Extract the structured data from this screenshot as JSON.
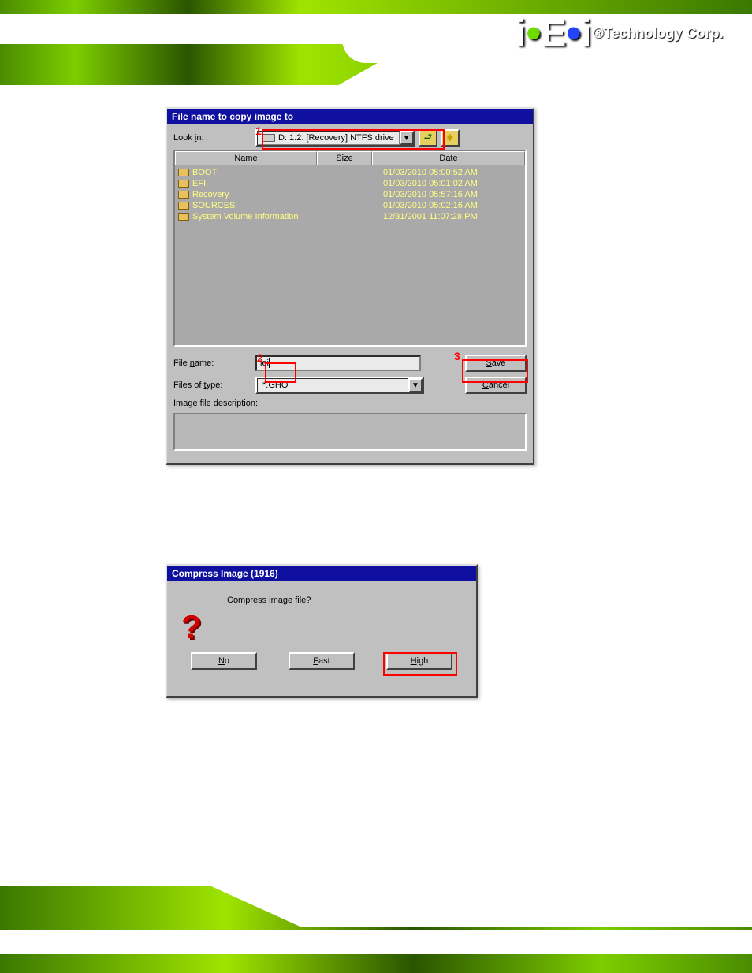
{
  "header": {
    "logo_text": "iEi",
    "tagline": "®Technology Corp."
  },
  "dialog1": {
    "title": "File name to copy image to",
    "look_in_label": "Look in:",
    "look_in_value": "D: 1.2: [Recovery] NTFS drive",
    "mark1": "1",
    "mark2": "2",
    "mark3": "3",
    "cols": {
      "name": "Name",
      "size": "Size",
      "date": "Date"
    },
    "rows": [
      {
        "name": "BOOT",
        "size": "",
        "date": "01/03/2010 05:00:52 AM"
      },
      {
        "name": "EFI",
        "size": "",
        "date": "01/03/2010 05:01:02 AM"
      },
      {
        "name": "Recovery",
        "size": "",
        "date": "01/03/2010 05:57:16 AM"
      },
      {
        "name": "SOURCES",
        "size": "",
        "date": "01/03/2010 05:02:16 AM"
      },
      {
        "name": "System Volume Information",
        "size": "",
        "date": "12/31/2001 11:07:28 PM"
      }
    ],
    "file_name_label": "File name:",
    "file_name_value": "iei",
    "files_type_label": "Files of type:",
    "files_type_value": "*.GHO",
    "desc_label": "Image file description:",
    "btn_save": "Save",
    "btn_cancel": "Cancel"
  },
  "dialog2": {
    "title": "Compress Image (1916)",
    "question": "Compress image file?",
    "btn_no": "No",
    "btn_fast": "Fast",
    "btn_high": "High"
  }
}
